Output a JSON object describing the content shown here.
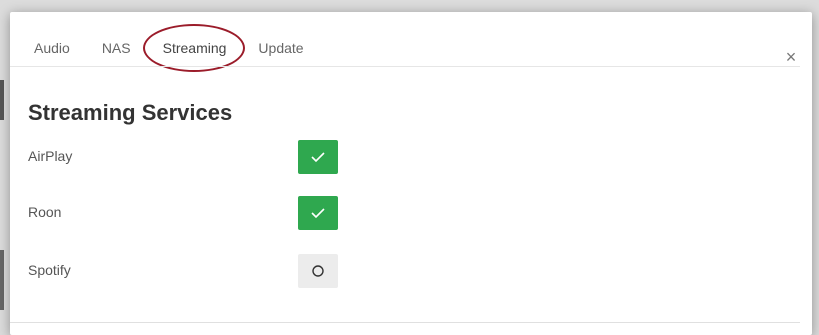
{
  "tabs": [
    {
      "label": "Audio",
      "active": false
    },
    {
      "label": "NAS",
      "active": false
    },
    {
      "label": "Streaming",
      "active": true
    },
    {
      "label": "Update",
      "active": false
    }
  ],
  "close_glyph": "×",
  "section": {
    "title": "Streaming Services"
  },
  "services": [
    {
      "label": "AirPlay",
      "enabled": true,
      "icon": "check-icon"
    },
    {
      "label": "Roon",
      "enabled": true,
      "icon": "check-icon"
    },
    {
      "label": "Spotify",
      "enabled": false,
      "icon": "circle-icon"
    }
  ],
  "colors": {
    "toggle_on": "#2fa84f",
    "toggle_off": "#ececec",
    "highlight_ring": "#9b1c2a"
  }
}
